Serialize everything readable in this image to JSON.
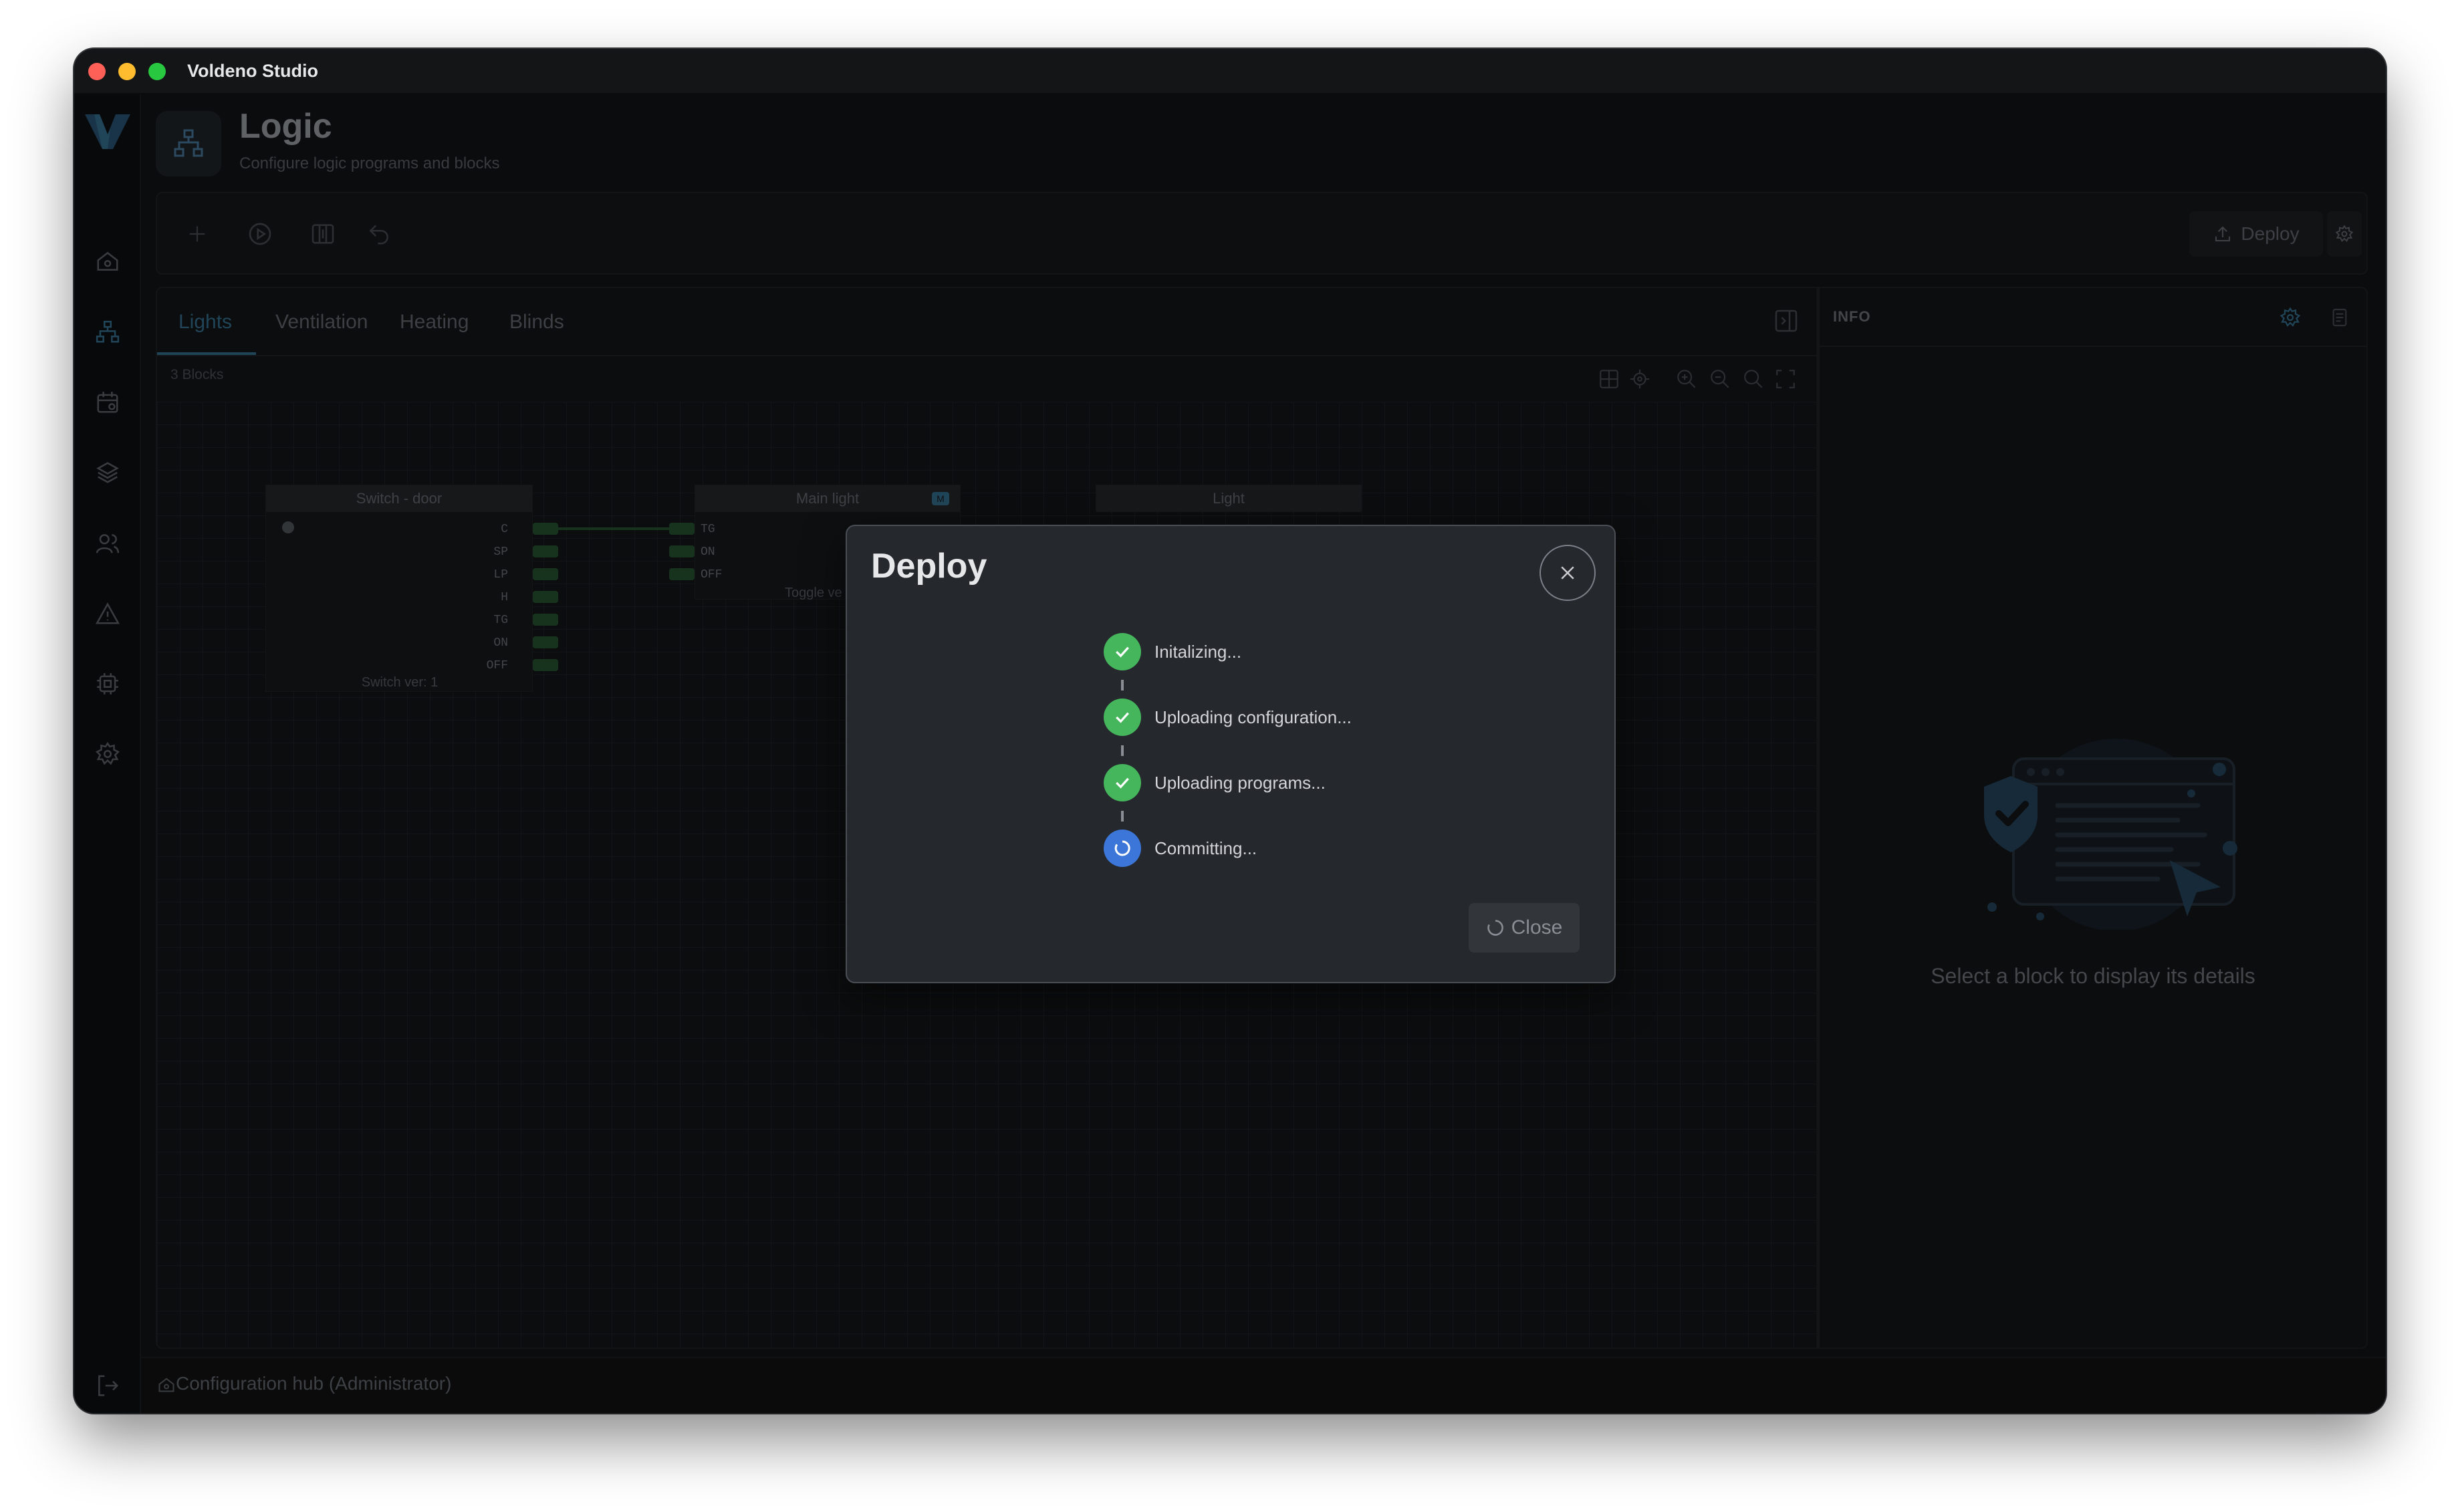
{
  "window": {
    "title": "Voldeno Studio"
  },
  "colors": {
    "accent": "#3d7ea1",
    "success": "#45b65c",
    "progress": "#3b76d8",
    "port": "#2c5e36"
  },
  "sidebar": {
    "logo": "V",
    "items": [
      {
        "icon": "home-icon"
      },
      {
        "icon": "logic-network-icon",
        "active": true
      },
      {
        "icon": "calendar-icon"
      },
      {
        "icon": "layers-icon"
      },
      {
        "icon": "users-icon"
      },
      {
        "icon": "warning-icon"
      },
      {
        "icon": "chip-icon"
      },
      {
        "icon": "gear-icon"
      }
    ],
    "bottom_icon": "logout-icon"
  },
  "header": {
    "title": "Logic",
    "subtitle": "Configure logic programs and blocks",
    "icon": "logic-network-icon"
  },
  "toolbar": {
    "deploy_label": "Deploy",
    "tools": [
      "add-icon",
      "play-icon",
      "columns-icon",
      "undo-icon"
    ]
  },
  "tabs": [
    {
      "label": "Lights",
      "active": true
    },
    {
      "label": "Ventilation"
    },
    {
      "label": "Heating"
    },
    {
      "label": "Blinds"
    }
  ],
  "canvas": {
    "block_count": "3 Blocks",
    "blocks": [
      {
        "title": "Switch - door",
        "ports": [
          "C",
          "SP",
          "LP",
          "H",
          "TG",
          "ON",
          "OFF"
        ],
        "footer": "Switch ver: 1"
      },
      {
        "title": "Main light",
        "badge": "M",
        "ports": [
          "TG",
          "ON",
          "OFF"
        ],
        "footer": "Toggle ve"
      },
      {
        "title": "Light"
      }
    ]
  },
  "info": {
    "title": "INFO",
    "hint": "Select a block to display its details"
  },
  "status": {
    "text": "Configuration hub (Administrator)"
  },
  "modal": {
    "title": "Deploy",
    "steps": [
      {
        "label": "Initalizing...",
        "state": "done"
      },
      {
        "label": "Uploading configuration...",
        "state": "done"
      },
      {
        "label": "Uploading programs...",
        "state": "done"
      },
      {
        "label": "Committing...",
        "state": "in-progress"
      }
    ],
    "close_label": "Close"
  }
}
